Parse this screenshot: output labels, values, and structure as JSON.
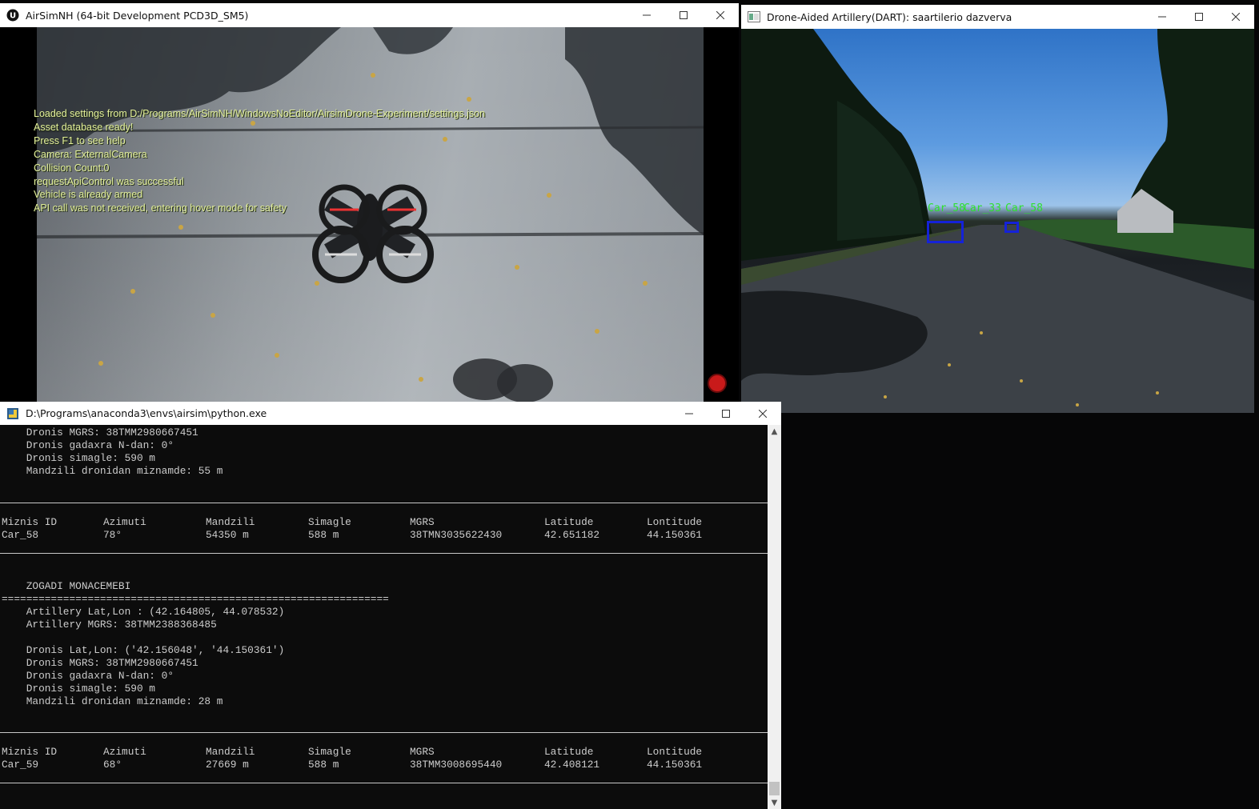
{
  "airsim": {
    "title": "AirSimNH (64-bit Development PCD3D_SM5)",
    "osd_lines": [
      "Loaded settings from D:/Programs/AirSimNH/WindowsNoEditor/AirsimDrone-Experiment/settings.json",
      "Asset database ready!",
      "Press F1 to see help",
      "Camera: ExternalCamera",
      "Collision Count:0",
      "requestApiControl was successful",
      "Vehicle is already armed",
      "API call was not received, entering hover mode for safety"
    ],
    "record_icon": "record-icon"
  },
  "dart": {
    "title": "Drone-Aided Artillery(DART): saartilerio dazverva",
    "detections": [
      "Car_58",
      "Car_33",
      "Car_58"
    ]
  },
  "console": {
    "title": "D:\\Programs\\anaconda3\\envs\\airsim\\python.exe",
    "top_lines": [
      "    Dronis MGRS: 38TMM2980667451",
      "    Dronis gadaxra N-dan: 0°",
      "    Dronis simagle: 590 m",
      "    Mandzili dronidan miznamde: 55 m"
    ],
    "headers": [
      "Miznis ID",
      "Azimuti",
      "Mandzili",
      "Simagle",
      "MGRS",
      "Latitude",
      "Lontitude"
    ],
    "row1": [
      "Car_58",
      "78°",
      "54350 m",
      "588 m",
      "38TMN3035622430",
      "42.651182",
      "44.150361"
    ],
    "section_title": "    ZOGADI MONACEMEBI",
    "equals_line": "===============================================================",
    "mid_lines": [
      "    Artillery Lat,Lon : (42.164805, 44.078532)",
      "    Artillery MGRS: 38TMM2388368485",
      "",
      "    Dronis Lat,Lon: ('42.156048', '44.150361')",
      "    Dronis MGRS: 38TMM2980667451",
      "    Dronis gadaxra N-dan: 0°",
      "    Dronis simagle: 590 m",
      "    Mandzili dronidan miznamde: 28 m"
    ],
    "row2": [
      "Car_59",
      "68°",
      "27669 m",
      "588 m",
      "38TMM3008695440",
      "42.408121",
      "44.150361"
    ]
  }
}
